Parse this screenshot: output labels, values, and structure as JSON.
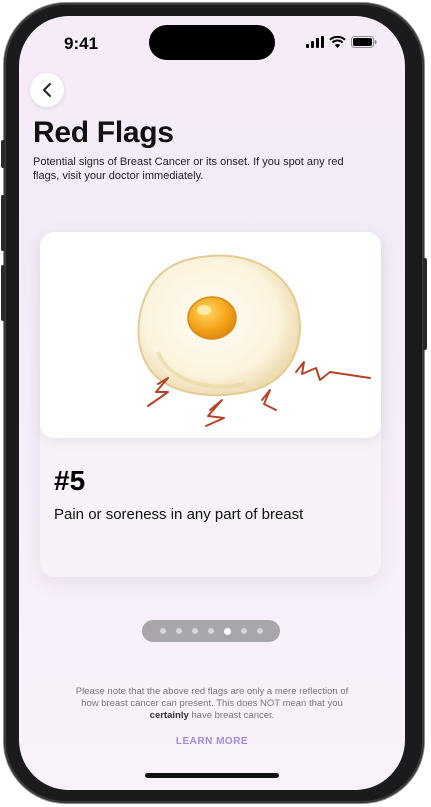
{
  "status_bar": {
    "time": "9:41"
  },
  "header": {
    "title": "Red Flags",
    "subtitle": "Potential signs of Breast Cancer or its onset. If you spot any red flags, visit your doctor immediately."
  },
  "card": {
    "number": "#5",
    "text": "Pain or soreness in any part of breast",
    "image_icon": "fried-egg-illustration"
  },
  "pager": {
    "total": 8,
    "active_index": 4
  },
  "disclaimer": {
    "before": "Please note that the  above red flags are only a mere reflection of how breast cancer can present. This does NOT mean that you ",
    "bold": "certainly",
    "after": " have breast cancer."
  },
  "learn_more_label": "LEARN MORE",
  "colors": {
    "accent": "#a58bd6",
    "background": "#f6eef9",
    "pain_lines": "#b5432a"
  }
}
